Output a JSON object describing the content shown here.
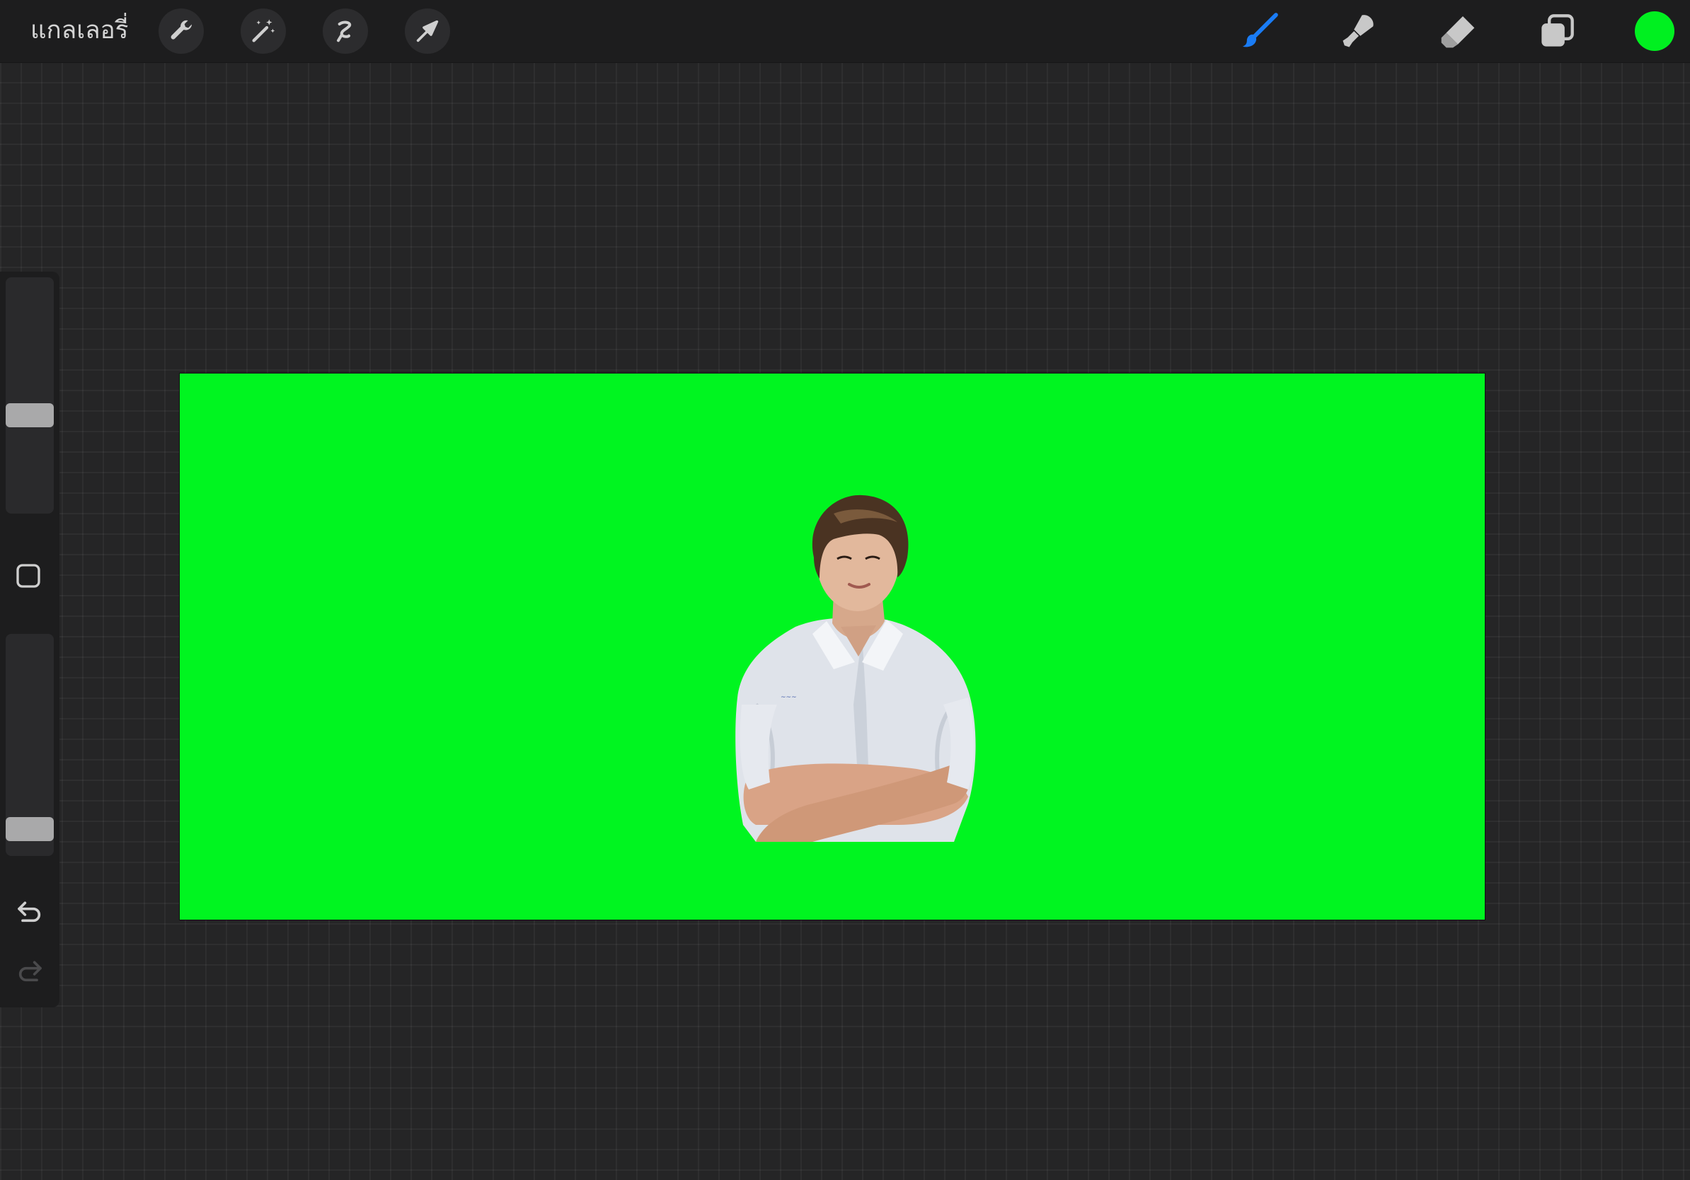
{
  "topbar": {
    "gallery_label": "แกลเลอรี่",
    "left_tools": [
      {
        "name": "wrench-icon",
        "action": "actions"
      },
      {
        "name": "magic-wand-icon",
        "action": "adjustments"
      },
      {
        "name": "selection-icon",
        "action": "selection"
      },
      {
        "name": "arrow-cursor-icon",
        "action": "transform"
      }
    ],
    "right_tools": [
      {
        "name": "brush-icon",
        "action": "paint",
        "active": true
      },
      {
        "name": "smudge-icon",
        "action": "smudge",
        "active": false
      },
      {
        "name": "eraser-icon",
        "action": "erase",
        "active": false
      },
      {
        "name": "layers-icon",
        "action": "layers",
        "active": false
      }
    ],
    "current_color": "#00f020"
  },
  "sidebar": {
    "brush_size_level": 0.4,
    "opacity_level": 0.05,
    "modify_button": "square-icon",
    "undo": {
      "icon": "undo-icon",
      "enabled": true
    },
    "redo": {
      "icon": "redo-icon",
      "enabled": false
    }
  },
  "canvas": {
    "background_color": "#00f520",
    "content": "photo-cutout-of-person"
  },
  "colors": {
    "active_tool": "#1a7cf5",
    "inactive_tool": "#c8c8c8",
    "app_background": "#252526",
    "toolbar": "#1d1d1e"
  }
}
